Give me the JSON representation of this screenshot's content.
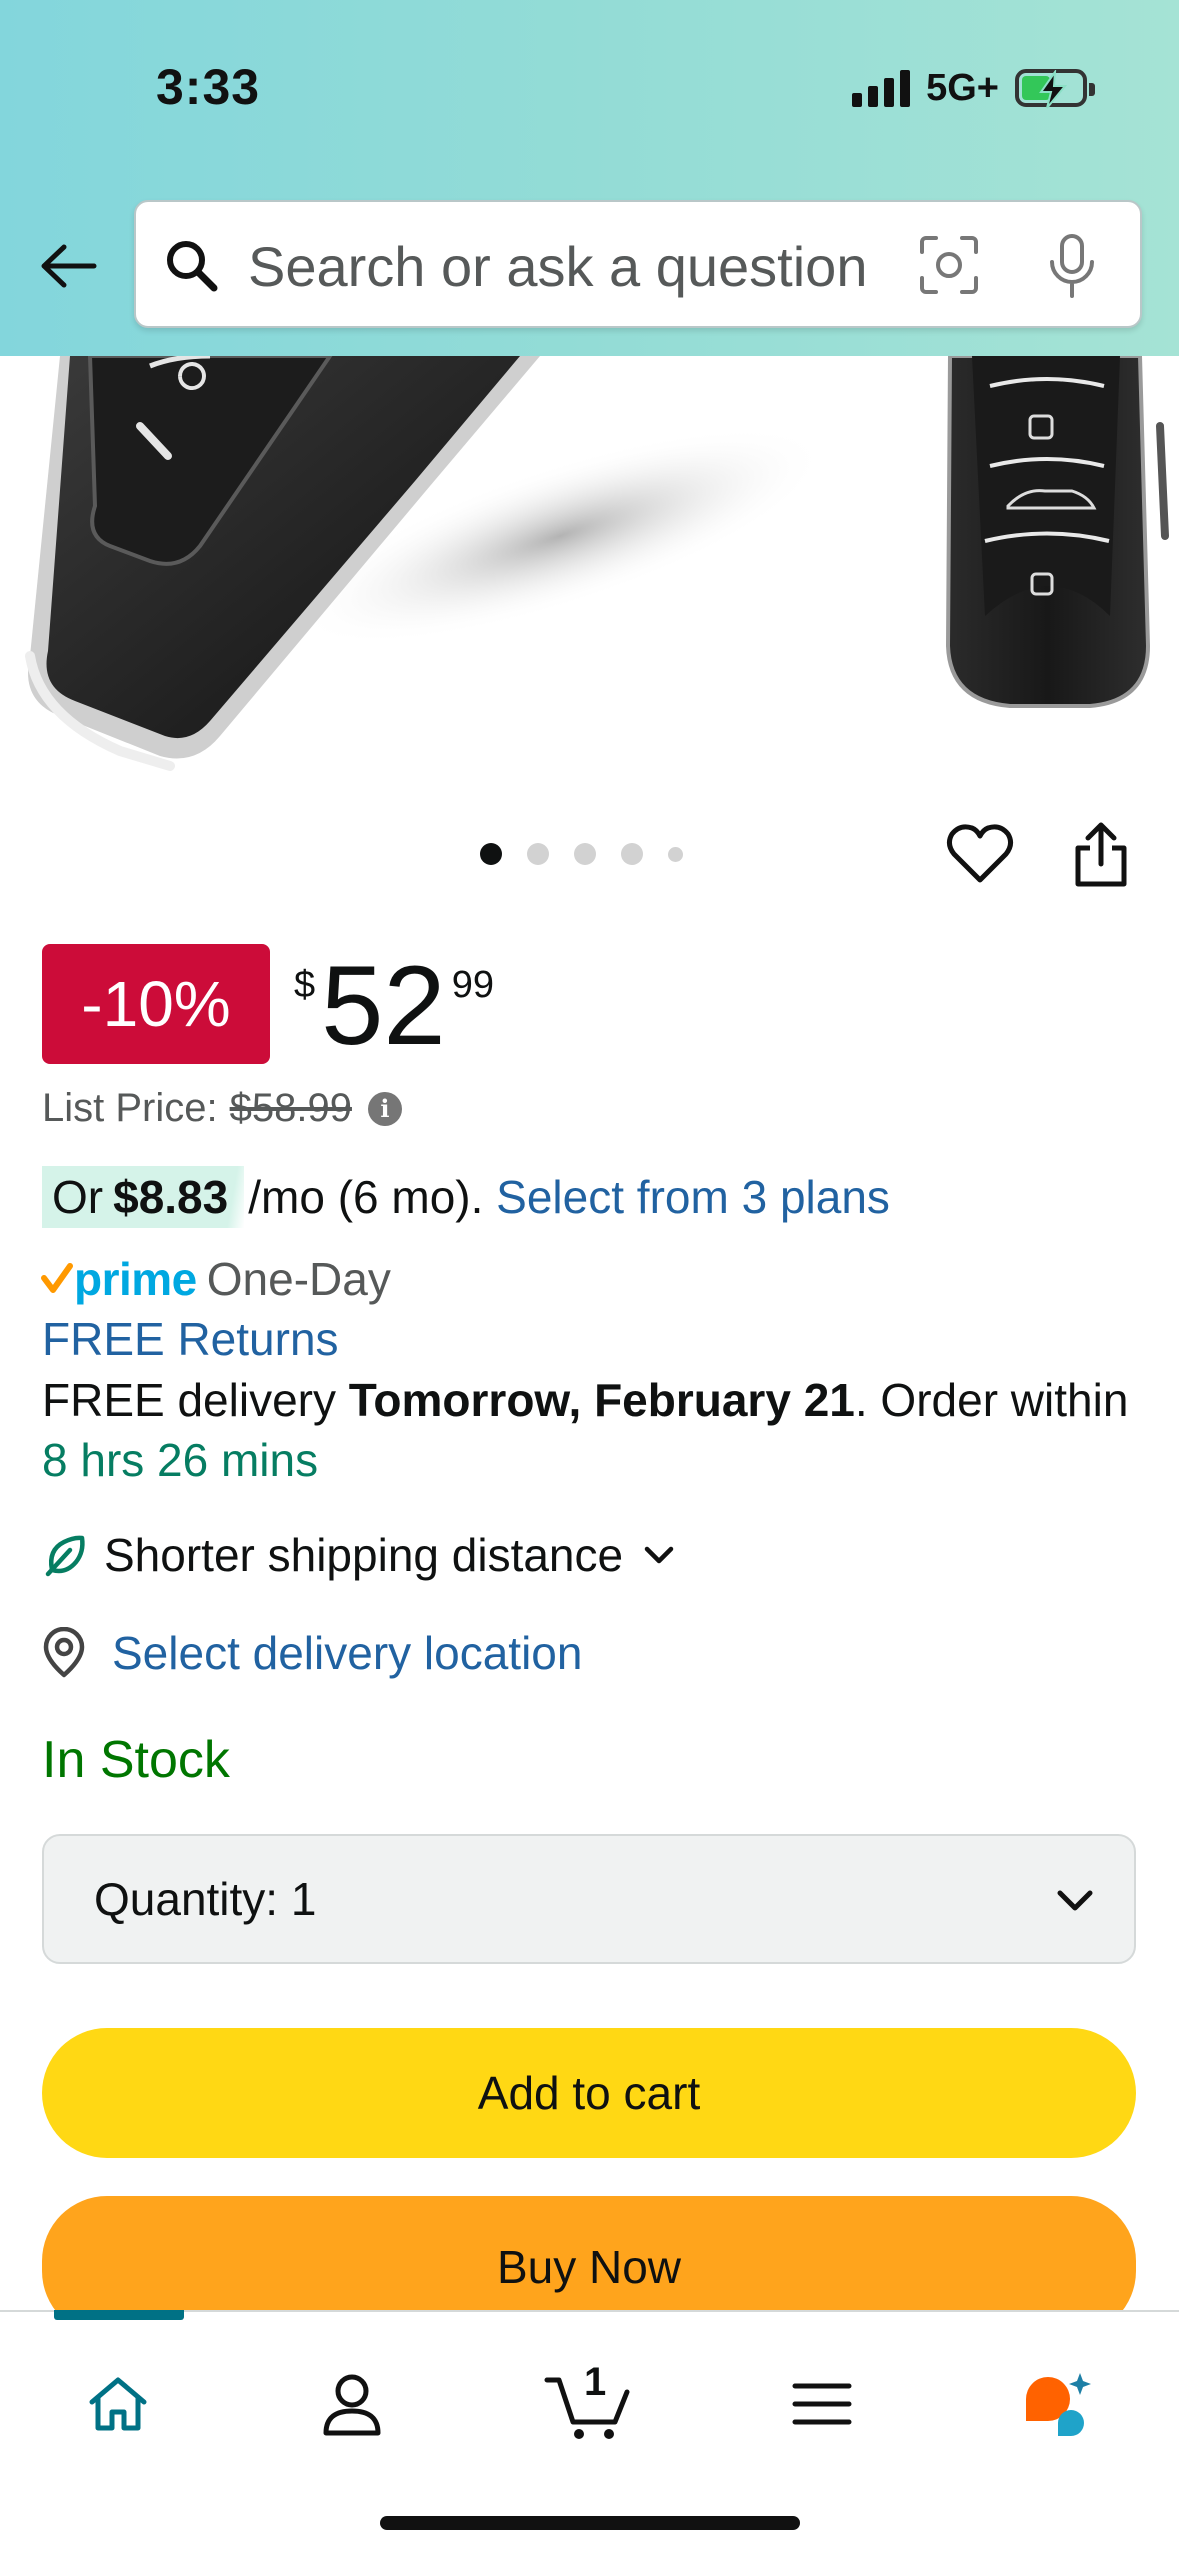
{
  "status_bar": {
    "time": "3:33",
    "network": "5G+"
  },
  "search": {
    "placeholder": "Search or ask a question"
  },
  "gallery": {
    "dot_count": 5,
    "active_index": 0
  },
  "price": {
    "discount": "-10%",
    "currency": "$",
    "whole": "52",
    "fraction": "99",
    "list_label": "List Price:",
    "list_value": "$58.99"
  },
  "installment": {
    "prefix": "Or",
    "amount": "$8.83",
    "term": "/mo (6 mo).",
    "plans_link": "Select from 3 plans"
  },
  "delivery": {
    "prime_label": "prime",
    "prime_speed": "One-Day",
    "free_returns": "FREE Returns",
    "free_delivery": "FREE delivery",
    "date": "Tomorrow, February 21",
    "order_within_pre": ". Order within",
    "countdown": "8 hrs 26 mins",
    "shorter_shipping": "Shorter shipping distance",
    "location_link": "Select delivery location"
  },
  "stock": {
    "status": "In Stock"
  },
  "quantity": {
    "label": "Quantity:",
    "value": "1"
  },
  "actions": {
    "add_to_cart": "Add to cart",
    "buy_now": "Buy Now"
  },
  "bottom_nav": {
    "cart_count": "1",
    "active": "home"
  },
  "colors": {
    "header_gradient_start": "#83d6dc",
    "header_gradient_end": "#a5e3d5",
    "discount_badge": "#cc0c39",
    "link": "#2162a1",
    "in_stock": "#007600",
    "countdown": "#067d62",
    "add_to_cart": "#ffd814",
    "buy_now": "#ffa41c",
    "prime": "#00a8e1",
    "nav_active": "#007185"
  }
}
